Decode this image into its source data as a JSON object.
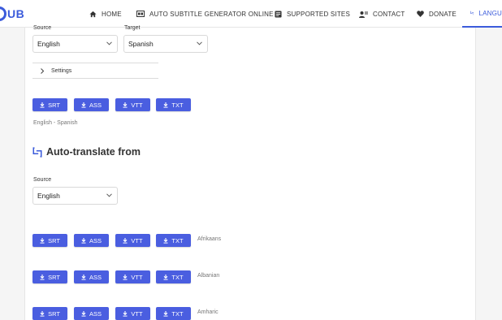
{
  "nav": {
    "logo_text": "UB",
    "items": [
      {
        "label": "HOME",
        "icon": "home-icon"
      },
      {
        "label": "AUTO SUBTITLE GENERATOR ONLINE",
        "icon": "cc-icon"
      },
      {
        "label": "SUPPORTED SITES",
        "icon": "list-icon"
      },
      {
        "label": "CONTACT",
        "icon": "contact-icon"
      },
      {
        "label": "DONATE",
        "icon": "heart-icon"
      },
      {
        "label": "LANGU",
        "icon": "translate-icon"
      }
    ],
    "accent": "#3b5bdb"
  },
  "translate_pair": {
    "source_label": "Source",
    "target_label": "Target",
    "source_value": "English",
    "target_value": "Spanish",
    "settings_label": "Settings",
    "pair_text": "English - Spanish"
  },
  "formats": [
    "SRT",
    "ASS",
    "VTT",
    "TXT"
  ],
  "auto_translate": {
    "heading": "Auto-translate from",
    "source_label": "Source",
    "source_value": "English",
    "languages": [
      "Afrikaans",
      "Albanian",
      "Amharic"
    ]
  },
  "colors": {
    "button": "#4a5ee0"
  }
}
